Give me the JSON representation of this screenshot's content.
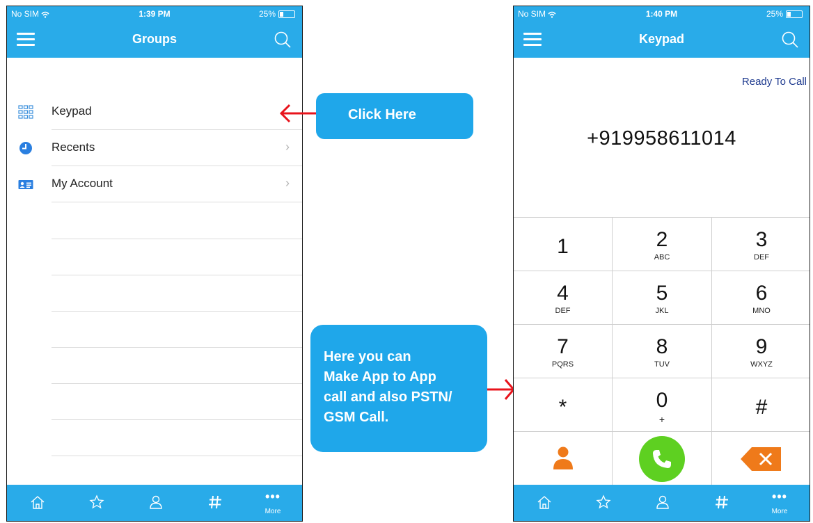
{
  "left_phone": {
    "status": {
      "carrier": "No SIM",
      "time": "1:39 PM",
      "battery": "25%",
      "battery_level": 0.25
    },
    "title": "Groups",
    "menu": [
      {
        "label": "Keypad",
        "icon": "keypad-grid-icon"
      },
      {
        "label": "Recents",
        "icon": "clock-icon"
      },
      {
        "label": "My Account",
        "icon": "id-card-icon"
      }
    ],
    "tabs": [
      "home-icon",
      "star-icon",
      "contact-icon",
      "hash-icon",
      "more-icon"
    ],
    "more_label": "More"
  },
  "right_phone": {
    "status": {
      "carrier": "No SIM",
      "time": "1:40 PM",
      "battery": "25%",
      "battery_level": 0.25
    },
    "title": "Keypad",
    "ready_status": "Ready To Call",
    "dialed_number": "+919958611014",
    "keys": [
      {
        "digit": "1",
        "letters": ""
      },
      {
        "digit": "2",
        "letters": "ABC"
      },
      {
        "digit": "3",
        "letters": "DEF"
      },
      {
        "digit": "4",
        "letters": "DEF"
      },
      {
        "digit": "5",
        "letters": "JKL"
      },
      {
        "digit": "6",
        "letters": "MNO"
      },
      {
        "digit": "7",
        "letters": "PQRS"
      },
      {
        "digit": "8",
        "letters": "TUV"
      },
      {
        "digit": "9",
        "letters": "WXYZ"
      },
      {
        "digit": "*",
        "letters": ""
      },
      {
        "digit": "0",
        "letters": "+"
      },
      {
        "digit": "#",
        "letters": ""
      }
    ],
    "more_label": "More"
  },
  "callouts": {
    "click_here": "Click Here",
    "description": "Here you can\nMake App to App\ncall and also PSTN/\nGSM Call."
  },
  "colors": {
    "header_blue": "#29abe9",
    "callout_blue": "#1fa7ea",
    "arrow_red": "#e8141c",
    "call_green": "#5ed021",
    "contact_orange": "#ef7a1a",
    "ready_text": "#1e3a8f"
  }
}
